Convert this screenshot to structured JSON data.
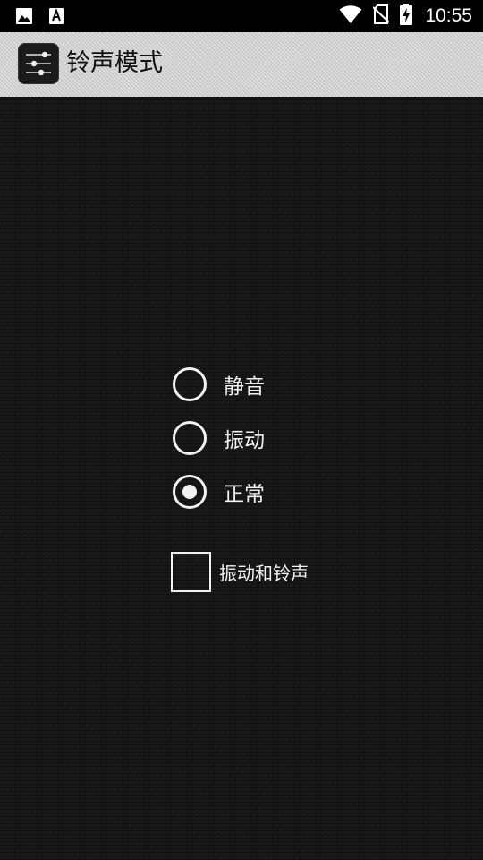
{
  "status_bar": {
    "time": "10:55",
    "icons": [
      "image-icon",
      "text-a-icon",
      "wifi-icon",
      "no-sim-icon",
      "battery-charging-icon"
    ]
  },
  "app_bar": {
    "title": "铃声模式",
    "icon": "sliders-icon"
  },
  "ringer_modes": {
    "options": [
      {
        "label": "静音",
        "selected": false
      },
      {
        "label": "振动",
        "selected": false
      },
      {
        "label": "正常",
        "selected": true
      }
    ]
  },
  "vibrate_and_ring": {
    "label": "振动和铃声",
    "checked": false
  },
  "colors": {
    "background": "#151515",
    "app_bar": "#cfcfcf",
    "foreground": "#f2f2f2",
    "status_bar": "#000000"
  }
}
